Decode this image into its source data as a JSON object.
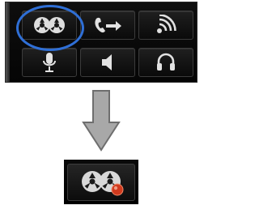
{
  "toolbar": {
    "buttons": [
      {
        "icon": "tape-reels-icon",
        "state": "selected"
      },
      {
        "icon": "call-forward-icon"
      },
      {
        "icon": "signal-waves-icon"
      },
      {
        "icon": "microphone-icon"
      },
      {
        "icon": "speaker-icon"
      },
      {
        "icon": "headset-icon"
      }
    ]
  },
  "result": {
    "icon": "tape-reels-recording-icon",
    "indicator_color": "#d03a1e"
  },
  "colors": {
    "highlight": "#2f6fd6",
    "arrow_fill": "#a8a8a8",
    "arrow_stroke": "#6e6e6e"
  }
}
